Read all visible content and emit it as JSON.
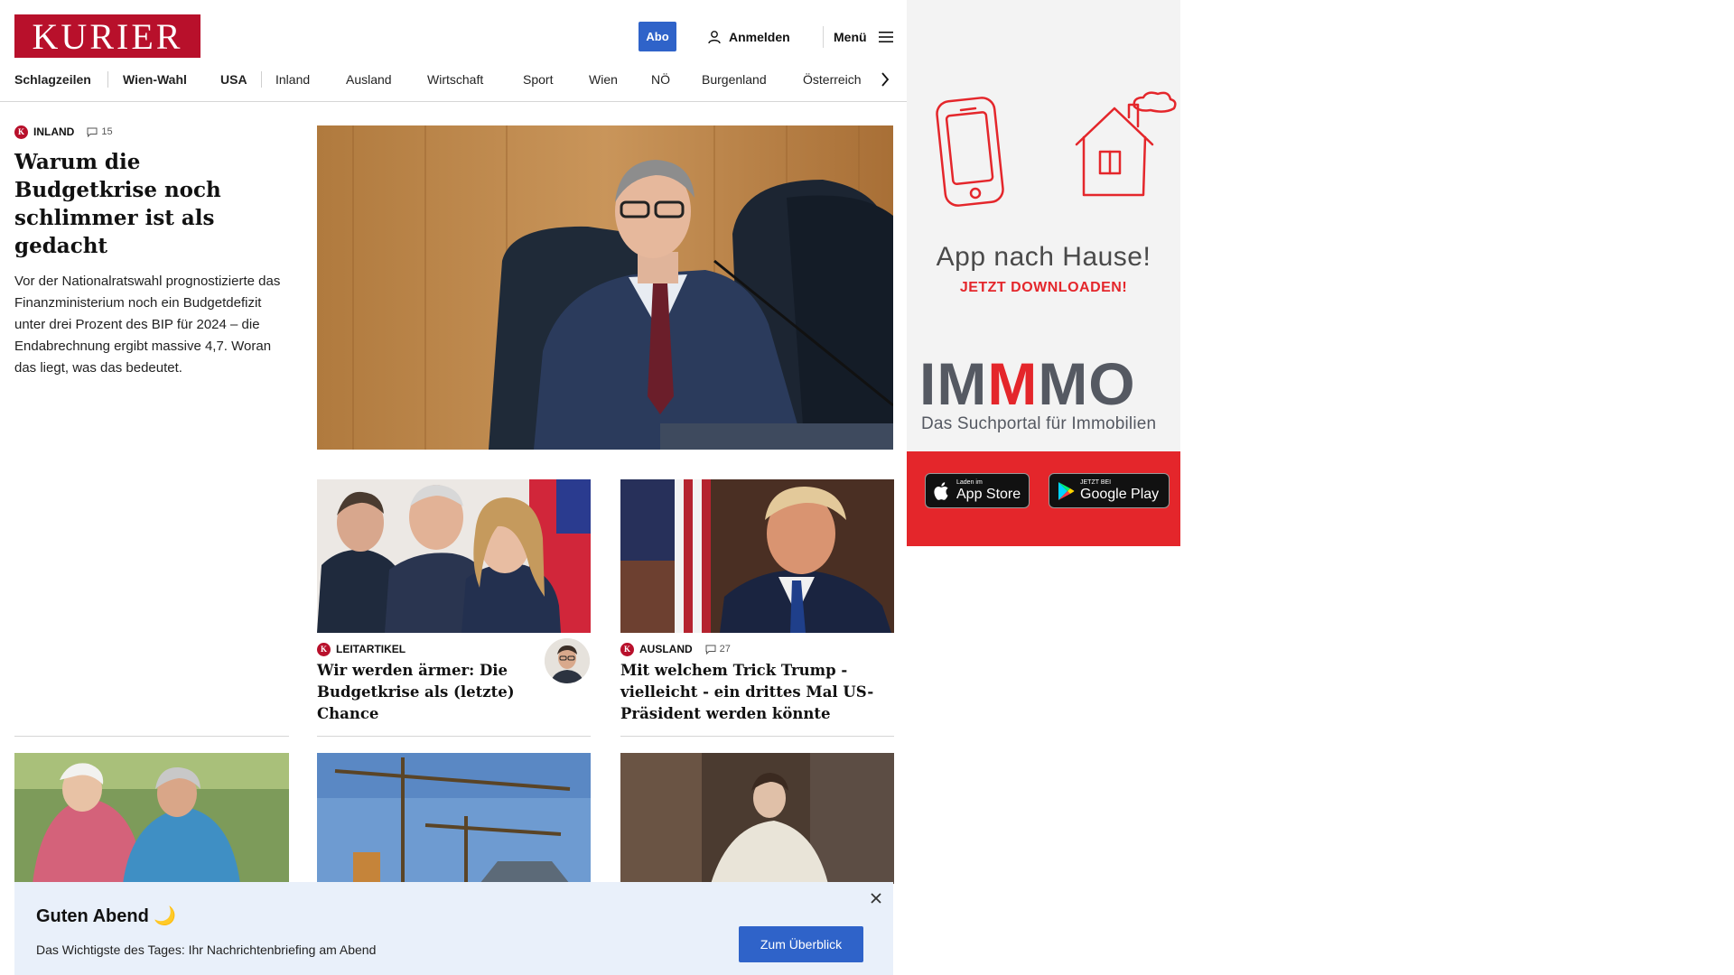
{
  "header": {
    "logo": "KURIER",
    "abo_label": "Abo",
    "login_label": "Anmelden",
    "menu_label": "Menü",
    "icons": {
      "login": "user-icon",
      "menu": "hamburger-icon",
      "nav_more": "chevron-right-icon"
    }
  },
  "nav": {
    "items": [
      "Schlagzeilen",
      "Wien-Wahl",
      "USA",
      "Inland",
      "Ausland",
      "Wirtschaft",
      "Sport",
      "Wien",
      "NÖ",
      "Burgenland",
      "Österreich"
    ]
  },
  "lead": {
    "category": "INLAND",
    "comment_count": "15",
    "title": "Warum die Budgetkrise noch schlimmer ist als gedacht",
    "teaser": "Vor der Nationalratswahl prognostizierte das Finanzministerium noch ein Budgetdefizit unter drei Prozent des BIP für 2024 – die Endabrechnung ergibt massive 4,7. Woran das liegt, was das bedeutet."
  },
  "cards": [
    {
      "category": "LEITARTIKEL",
      "title": "Wir werden ärmer: Die Budgetkrise als (letzte) Chance"
    },
    {
      "category": "AUSLAND",
      "comment_count": "27",
      "title": "Mit welchem Trick Trump - vielleicht - ein drittes Mal US-Präsident werden könnte"
    }
  ],
  "badge_letter": "K",
  "ad": {
    "headline": "App nach Hause!",
    "subline": "JETZT DOWNLOADEN!",
    "brand_a": "IM",
    "brand_b": "M",
    "brand_c": "MO",
    "tagline": "Das Suchportal für Immobilien",
    "appstore_small": "Laden im",
    "appstore_big": "App Store",
    "googleplay_small": "JETZT BEI",
    "googleplay_big": "Google Play",
    "colors": {
      "red": "#e4262b",
      "gray": "#555962"
    }
  },
  "notification": {
    "title": "Guten Abend 🌙",
    "text": "Das Wichtigste des Tages: Ihr Nachrichtenbriefing am Abend",
    "button": "Zum Überblick"
  },
  "colors": {
    "brand": "#b8102b",
    "primary_button": "#2f63c9",
    "notification_bg": "#e9f0fa"
  }
}
